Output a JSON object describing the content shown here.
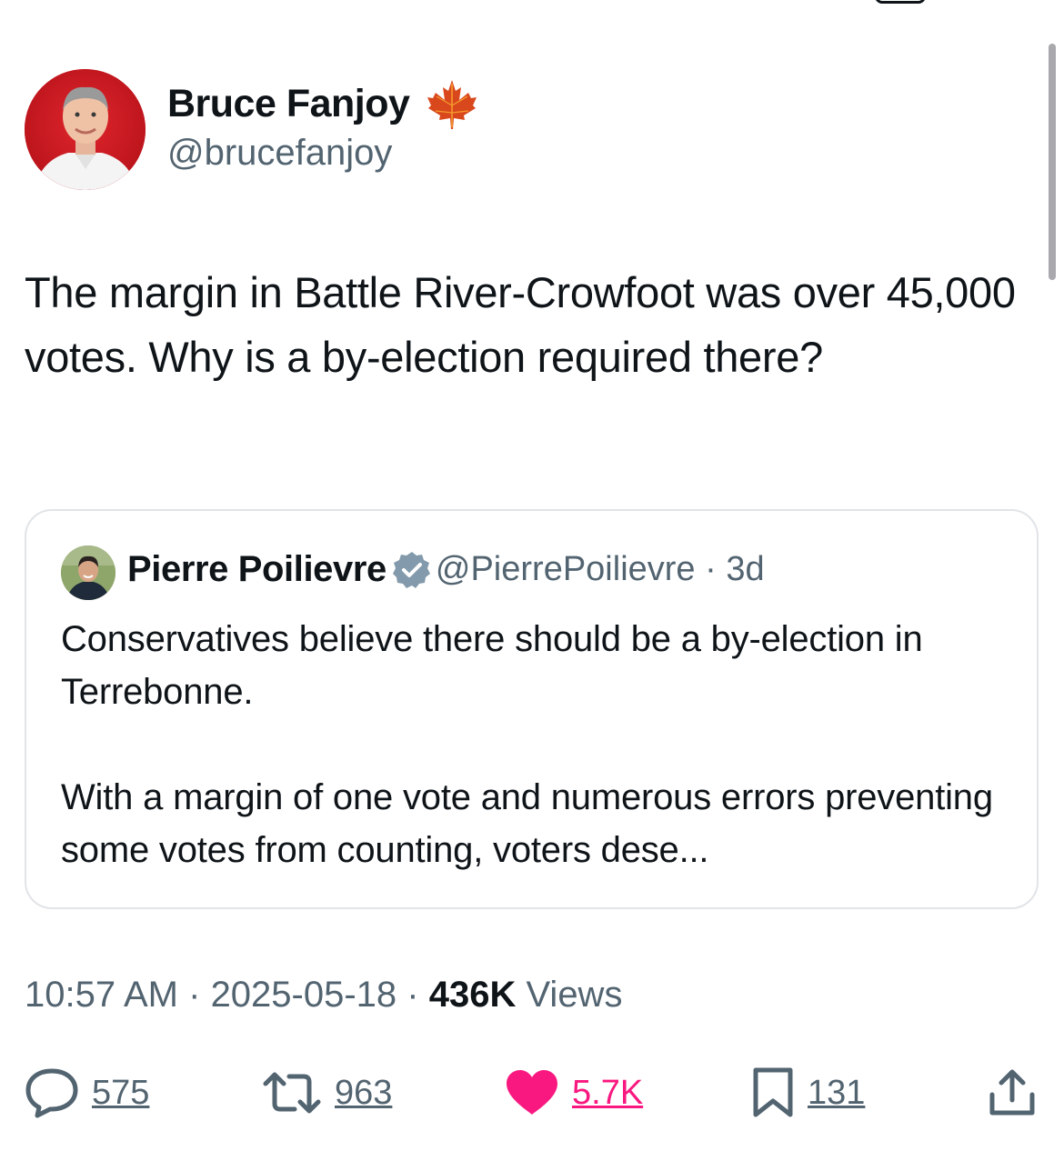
{
  "author": {
    "name": "Bruce Fanjoy",
    "handle": "@brucefanjoy",
    "badge_icon": "maple-leaf-icon"
  },
  "tweet": {
    "text": "The margin in Battle River-Crowfoot was over 45,000 votes. Why is a by-election required there?"
  },
  "quoted_tweet": {
    "name": "Pierre Poilievre",
    "handle": "@PierrePoilievre",
    "time": "3d",
    "verified_icon": "verified-badge-icon",
    "paragraph1": "Conservatives believe there should be a by-election in Terrebonne.",
    "paragraph2": "With a margin of one vote and numerous errors preventing some votes from counting, voters dese..."
  },
  "meta": {
    "time": "10:57 AM",
    "date": "2025-05-18",
    "views_count": "436K",
    "views_label": "Views"
  },
  "actions": {
    "replies": "575",
    "reposts": "963",
    "likes": "5.7K",
    "bookmarks": "131"
  },
  "colors": {
    "text": "#0f1419",
    "secondary": "#536471",
    "like": "#f91880",
    "verified": "#829aab",
    "border": "#e1e4e8"
  }
}
